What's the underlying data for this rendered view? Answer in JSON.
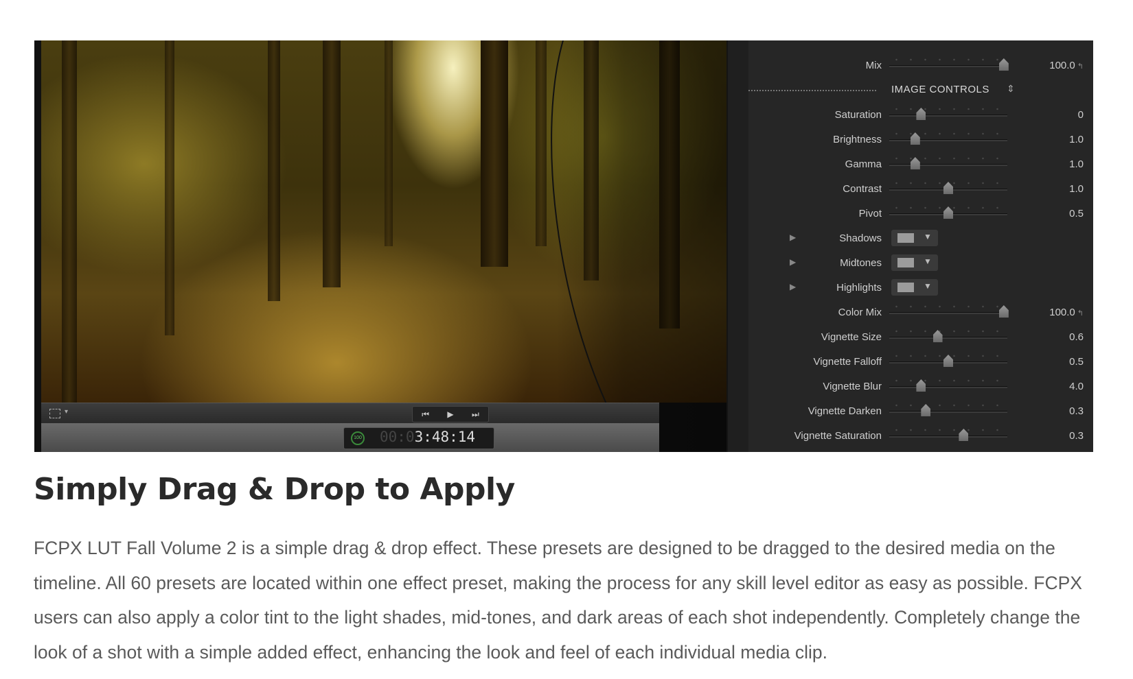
{
  "timecode": {
    "dim": "00:0",
    "main": "3:48:14",
    "dial": "100"
  },
  "transport": {
    "prev": "⏮",
    "play": "▶",
    "next": "⏭"
  },
  "inspector": {
    "top_row": {
      "label": "Mix",
      "value": "100.0",
      "fraction": 0.97
    },
    "section_title": "IMAGE CONTROLS",
    "sliders": [
      {
        "label": "Saturation",
        "value": "0",
        "fraction": 0.27
      },
      {
        "label": "Brightness",
        "value": "1.0",
        "fraction": 0.22
      },
      {
        "label": "Gamma",
        "value": "1.0",
        "fraction": 0.22
      },
      {
        "label": "Contrast",
        "value": "1.0",
        "fraction": 0.5
      },
      {
        "label": "Pivot",
        "value": "0.5",
        "fraction": 0.5
      }
    ],
    "swatches": [
      {
        "label": "Shadows"
      },
      {
        "label": "Midtones"
      },
      {
        "label": "Highlights"
      }
    ],
    "sliders2": [
      {
        "label": "Color Mix",
        "value": "100.0",
        "fraction": 0.97
      },
      {
        "label": "Vignette Size",
        "value": "0.6",
        "fraction": 0.41
      },
      {
        "label": "Vignette Falloff",
        "value": "0.5",
        "fraction": 0.5
      },
      {
        "label": "Vignette Blur",
        "value": "4.0",
        "fraction": 0.27
      },
      {
        "label": "Vignette Darken",
        "value": "0.3",
        "fraction": 0.31
      },
      {
        "label": "Vignette Saturation",
        "value": "0.3",
        "fraction": 0.63
      }
    ]
  },
  "heading": "Simply Drag & Drop to Apply",
  "paragraph": "FCPX LUT Fall Volume 2 is a simple drag & drop effect. These presets are designed to be dragged to the desired media on the timeline. All 60 presets are located within one effect preset, making the process for any skill level editor as easy as possible. FCPX users can also apply a color tint to the light shades, mid-tones, and dark areas of each shot independently. Completely change the look of a shot with a simple added effect, enhancing the look and feel of each individual media clip."
}
